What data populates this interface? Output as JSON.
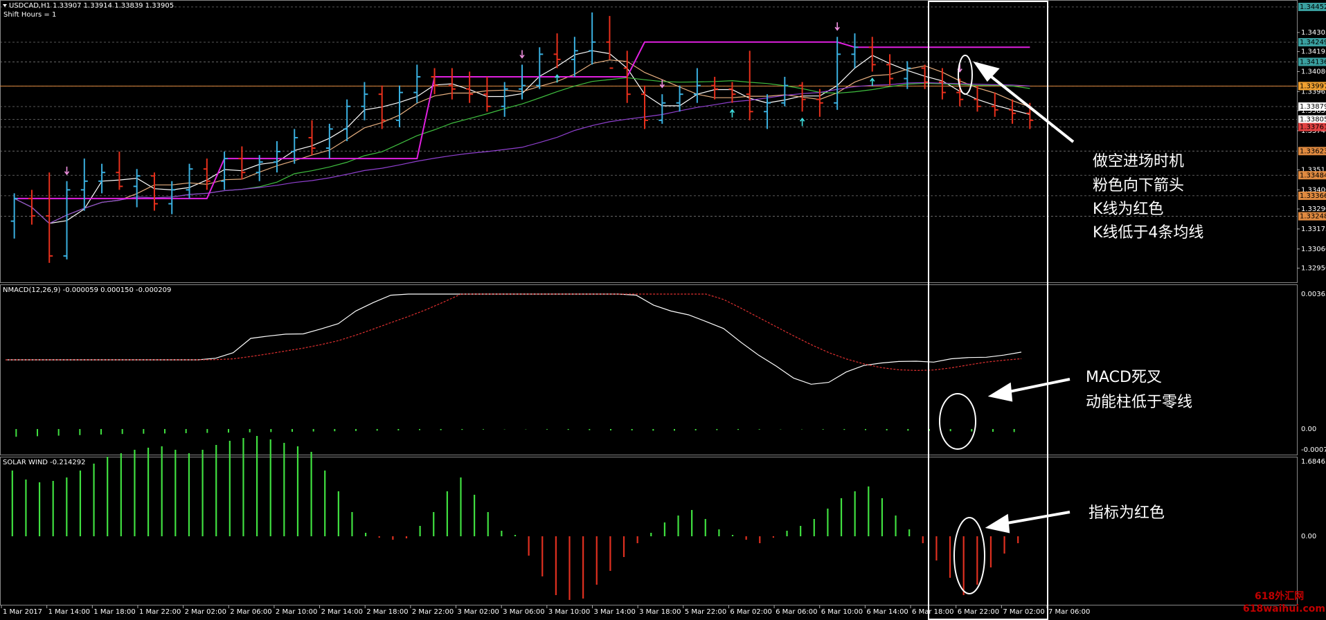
{
  "window": {
    "symbol_title": "USDCAD,H1  1.33907 1.33914 1.33839 1.33905",
    "subtitle": "Shift Hours = 1"
  },
  "colors": {
    "background": "#000000",
    "bull": "#3ab0e0",
    "bear": "#e8301c",
    "ma_white": "#ffffff",
    "ma_tan": "#e8b080",
    "ma_green": "#40c040",
    "ma_purple": "#9040d0",
    "magenta_step": "#e020e0",
    "arrow_pink": "#f090e0",
    "arrow_cyan": "#40e0e0",
    "grid": "#777777",
    "orange_line": "#e08a40",
    "hist_green": "#40e040",
    "hist_red": "#e03020"
  },
  "main_axis": {
    "ticks": [
      "1.34305",
      "1.34195",
      "1.34080",
      "1.33965",
      "1.33855",
      "1.33740",
      "1.33515",
      "1.33400",
      "1.33290",
      "1.33175",
      "1.33060",
      "1.32950"
    ],
    "tags": [
      {
        "label": "1.34452",
        "color": "#3aa0a0"
      },
      {
        "label": "1.34249",
        "color": "#3aa0a0"
      },
      {
        "label": "1.34136",
        "color": "#3aa0a0"
      },
      {
        "label": "1.33997",
        "color": "#f0a030"
      },
      {
        "label": "1.33879",
        "color": "#ffffff"
      },
      {
        "label": "1.33805",
        "color": "#ffffff"
      },
      {
        "label": "1.33761",
        "color": "#e04040"
      },
      {
        "label": "1.33623",
        "color": "#e08a40"
      },
      {
        "label": "1.33484",
        "color": "#e08a40"
      },
      {
        "label": "1.33366",
        "color": "#e08a40"
      },
      {
        "label": "1.33248",
        "color": "#e08a40"
      }
    ]
  },
  "macd": {
    "title": "NMACD(12,26,9) -0.000059 0.000150 -0.000209",
    "top_label": "0.003656",
    "zero_label": "0.00",
    "bottom_label": "-0.000752"
  },
  "solar": {
    "title": "SOLAR WIND -0.214292",
    "top_label": "1.684633",
    "zero_label": "0.00"
  },
  "time_axis": {
    "labels": [
      "1 Mar 2017",
      "1 Mar 14:00",
      "1 Mar 18:00",
      "1 Mar 22:00",
      "2 Mar 02:00",
      "2 Mar 06:00",
      "2 Mar 10:00",
      "2 Mar 14:00",
      "2 Mar 18:00",
      "2 Mar 22:00",
      "3 Mar 02:00",
      "3 Mar 06:00",
      "3 Mar 10:00",
      "3 Mar 14:00",
      "3 Mar 18:00",
      "5 Mar 22:00",
      "6 Mar 02:00",
      "6 Mar 06:00",
      "6 Mar 10:00",
      "6 Mar 14:00",
      "6 Mar 18:00",
      "6 Mar 22:00",
      "7 Mar 02:00",
      "7 Mar 06:00"
    ]
  },
  "annotations": {
    "short_entry": [
      "做空进场时机",
      "粉色向下箭头",
      "K线为红色",
      "K线低于4条均线"
    ],
    "macd_note": [
      "MACD死叉",
      "动能柱低于零线"
    ],
    "solar_note": [
      "指标为红色"
    ]
  },
  "watermark": {
    "line1": "618外汇网",
    "line2": "618waihui.com"
  },
  "chart_data": {
    "type": "bar",
    "price_range": [
      1.329,
      1.3446
    ],
    "candles": [
      [
        1.3322,
        1.3338,
        1.3312,
        1.3335
      ],
      [
        1.3335,
        1.334,
        1.332,
        1.3325
      ],
      [
        1.3325,
        1.335,
        1.3298,
        1.3302
      ],
      [
        1.3302,
        1.3345,
        1.33,
        1.334
      ],
      [
        1.334,
        1.3358,
        1.3328,
        1.3345
      ],
      [
        1.3345,
        1.3355,
        1.3338,
        1.335
      ],
      [
        1.335,
        1.3362,
        1.334,
        1.3342
      ],
      [
        1.3342,
        1.3352,
        1.333,
        1.3348
      ],
      [
        1.3348,
        1.335,
        1.3328,
        1.3332
      ],
      [
        1.3332,
        1.3345,
        1.3326,
        1.334
      ],
      [
        1.334,
        1.3355,
        1.3335,
        1.3352
      ],
      [
        1.3352,
        1.3358,
        1.334,
        1.3345
      ],
      [
        1.3345,
        1.3362,
        1.334,
        1.3358
      ],
      [
        1.3358,
        1.3365,
        1.3346,
        1.335
      ],
      [
        1.335,
        1.336,
        1.3345,
        1.3356
      ],
      [
        1.3356,
        1.3368,
        1.335,
        1.3362
      ],
      [
        1.3362,
        1.3375,
        1.3355,
        1.337
      ],
      [
        1.337,
        1.338,
        1.336,
        1.3364
      ],
      [
        1.3364,
        1.3378,
        1.3358,
        1.3375
      ],
      [
        1.3375,
        1.3392,
        1.3368,
        1.3388
      ],
      [
        1.3388,
        1.3402,
        1.338,
        1.3395
      ],
      [
        1.3395,
        1.34,
        1.3375,
        1.338
      ],
      [
        1.338,
        1.34,
        1.3376,
        1.3396
      ],
      [
        1.3396,
        1.3412,
        1.339,
        1.3405
      ],
      [
        1.3405,
        1.341,
        1.3395,
        1.34
      ],
      [
        1.34,
        1.341,
        1.3392,
        1.3398
      ],
      [
        1.3398,
        1.3408,
        1.339,
        1.3395
      ],
      [
        1.3395,
        1.3405,
        1.3385,
        1.3388
      ],
      [
        1.3388,
        1.3402,
        1.3382,
        1.3398
      ],
      [
        1.3398,
        1.3412,
        1.3392,
        1.34
      ],
      [
        1.34,
        1.3422,
        1.3398,
        1.3418
      ],
      [
        1.3418,
        1.343,
        1.341,
        1.3415
      ],
      [
        1.3415,
        1.3428,
        1.3405,
        1.342
      ],
      [
        1.342,
        1.3442,
        1.3412,
        1.3425
      ],
      [
        1.3425,
        1.344,
        1.3415,
        1.341
      ],
      [
        1.341,
        1.342,
        1.339,
        1.3395
      ],
      [
        1.3395,
        1.34,
        1.3375,
        1.338
      ],
      [
        1.338,
        1.3395,
        1.3378,
        1.339
      ],
      [
        1.339,
        1.34,
        1.3385,
        1.3395
      ],
      [
        1.3395,
        1.341,
        1.339,
        1.34
      ],
      [
        1.34,
        1.3405,
        1.3392,
        1.3398
      ],
      [
        1.3398,
        1.3402,
        1.339,
        1.3395
      ],
      [
        1.3395,
        1.342,
        1.338,
        1.3385
      ],
      [
        1.3385,
        1.3395,
        1.3375,
        1.339
      ],
      [
        1.339,
        1.3405,
        1.3388,
        1.34
      ],
      [
        1.34,
        1.3402,
        1.3385,
        1.3392
      ],
      [
        1.3392,
        1.3398,
        1.3382,
        1.339
      ],
      [
        1.339,
        1.3428,
        1.3386,
        1.3418
      ],
      [
        1.3418,
        1.343,
        1.341,
        1.3422
      ],
      [
        1.3422,
        1.3428,
        1.3408,
        1.3412
      ],
      [
        1.3412,
        1.3418,
        1.34,
        1.3404
      ],
      [
        1.3404,
        1.3414,
        1.3398,
        1.341
      ],
      [
        1.341,
        1.3412,
        1.3398,
        1.3402
      ],
      [
        1.3402,
        1.341,
        1.3392,
        1.3396
      ],
      [
        1.3396,
        1.3404,
        1.3388,
        1.3392
      ],
      [
        1.3392,
        1.34,
        1.3385,
        1.3388
      ],
      [
        1.3388,
        1.3396,
        1.3382,
        1.3386
      ],
      [
        1.3386,
        1.3392,
        1.3378,
        1.3384
      ],
      [
        1.3384,
        1.339,
        1.3375,
        1.338
      ]
    ],
    "arrows": {
      "sell_bar_index": [
        3,
        29,
        37,
        47,
        54
      ],
      "buy_bar_index": [
        31,
        41,
        45,
        49
      ]
    },
    "macd_hist": [
      -0.00028,
      -0.00026,
      -0.00024,
      -0.00022,
      -0.0002,
      -0.00018,
      -0.00017,
      -0.00016,
      -0.00015,
      -0.00014,
      -0.00013,
      -0.00012,
      -0.00011,
      -0.0001,
      -9e-05,
      -8e-05,
      -7e-05,
      -6e-05,
      -5e-05,
      -4e-05,
      -4e-05,
      -3e-05,
      -2e-05,
      -1e-05,
      1e-05,
      2e-05,
      3e-05,
      4e-05,
      5e-05,
      5e-05,
      6e-05,
      6e-05,
      5e-05,
      4e-05,
      3e-05,
      2e-05,
      1e-05,
      -1e-05,
      -2e-05,
      -3e-05,
      -4e-05,
      -5e-05,
      -6e-05,
      -7e-05,
      -8e-05,
      -9e-05,
      -0.0001,
      -0.00011
    ],
    "solar_wind": [
      0.95,
      0.82,
      0.78,
      0.8,
      0.85,
      0.95,
      1.05,
      1.15,
      1.2,
      1.25,
      1.28,
      1.3,
      1.25,
      1.2,
      1.25,
      1.32,
      1.38,
      1.42,
      1.45,
      1.4,
      1.35,
      1.3,
      1.22,
      0.95,
      0.65,
      0.35,
      0.05,
      -0.02,
      -0.05,
      -0.03,
      0.15,
      0.35,
      0.65,
      0.85,
      0.6,
      0.35,
      0.08,
      0.02,
      -0.28,
      -0.58,
      -0.85,
      -0.92,
      -0.9,
      -0.7,
      -0.5,
      -0.3,
      -0.1,
      0.05,
      0.2,
      0.3,
      0.38,
      0.25,
      0.1,
      0.02,
      -0.05,
      -0.1,
      -0.02,
      0.08,
      0.15,
      0.25,
      0.4,
      0.55,
      0.65,
      0.72,
      0.55,
      0.3,
      0.1,
      -0.1,
      -0.35,
      -0.6,
      -0.85,
      -0.7,
      -0.45,
      -0.25,
      -0.1
    ]
  }
}
